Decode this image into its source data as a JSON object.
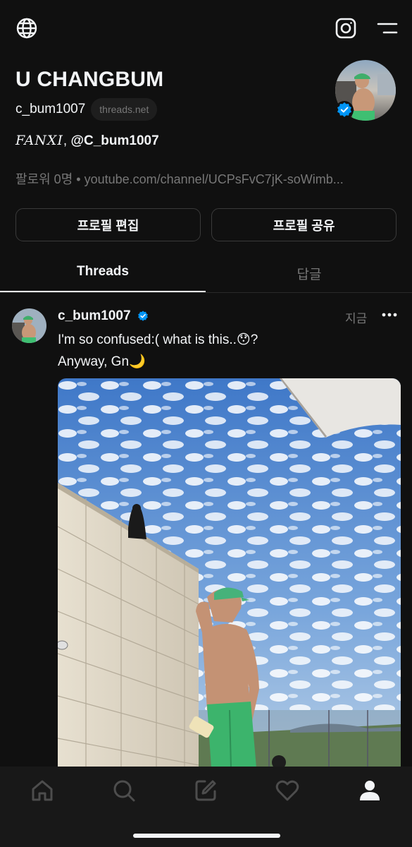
{
  "profile": {
    "name": "U CHANGBUM",
    "handle": "c_bum1007",
    "domain": "threads.net",
    "bio_fancy": "FANXI",
    "bio_sep": ", ",
    "bio_mention": "@C_bum1007",
    "followers": "팔로워 0명",
    "separator": " • ",
    "link": "youtube.com/channel/UCPsFvC7jK-soWimb..."
  },
  "buttons": {
    "edit_profile": "프로필 편집",
    "share_profile": "프로필 공유"
  },
  "tabs": [
    {
      "label": "Threads",
      "active": true
    },
    {
      "label": "답글",
      "active": false
    }
  ],
  "post": {
    "username": "c_bum1007",
    "time": "지금",
    "line1": "I'm so confused:( what is this..😯?",
    "line2": "Anyway, Gn🌙"
  },
  "icons": {
    "top_left": "globe-icon",
    "top_right": [
      "instagram-icon",
      "menu-icon"
    ],
    "nav": [
      "home-icon",
      "search-icon",
      "compose-icon",
      "heart-icon",
      "profile-icon"
    ]
  },
  "colors": {
    "background": "#101010",
    "text": "#f3f5f7",
    "muted": "#777777",
    "verified": "#0095f6",
    "nav_bg": "#181818"
  }
}
